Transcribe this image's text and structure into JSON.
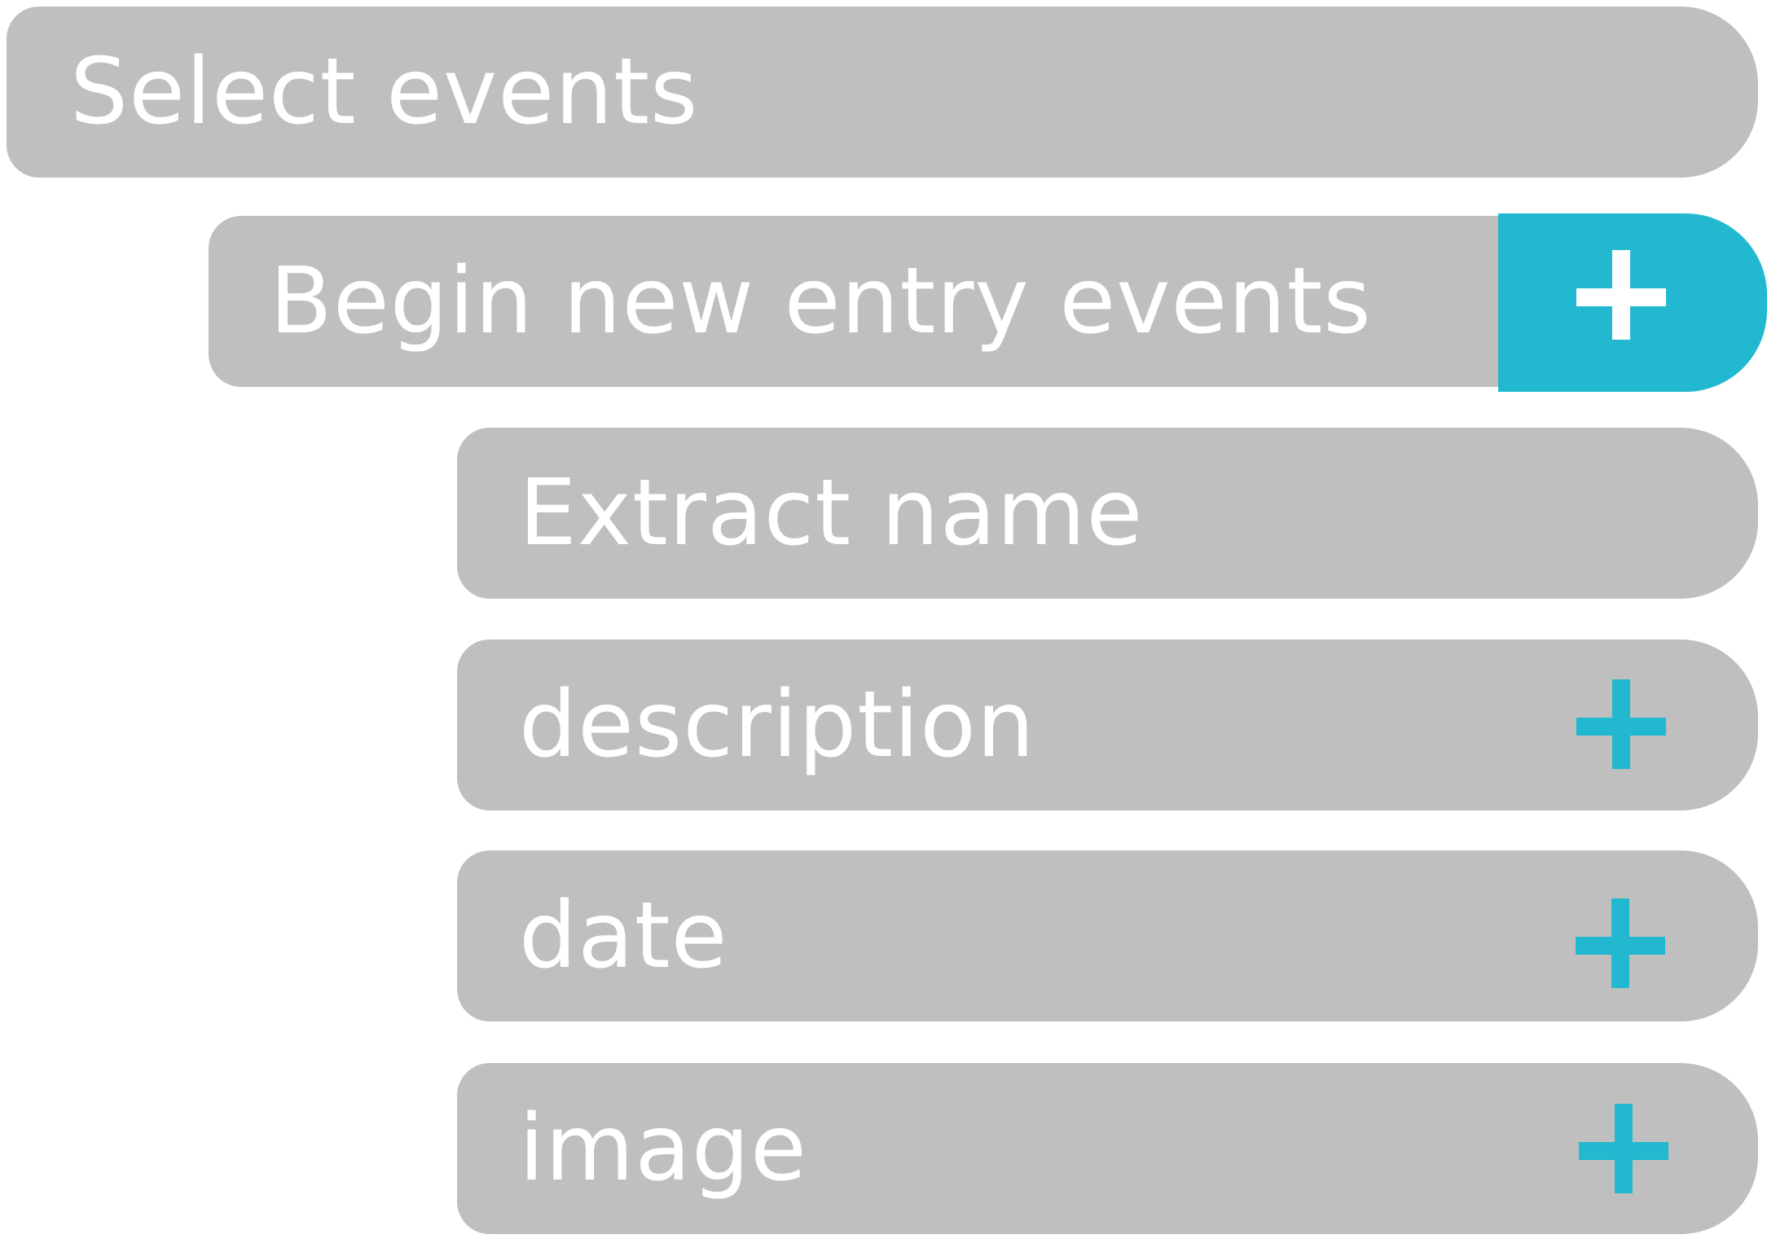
{
  "rows": {
    "select_events": "Select events",
    "begin_new_entry_events": "Begin new entry events",
    "extract_name": "Extract name",
    "description": "description",
    "date": "date",
    "image": "image"
  },
  "icons": {
    "add": "plus-icon"
  },
  "colors": {
    "row_bg": "#bfbfbf",
    "accent": "#22b9d0",
    "text": "#ffffff"
  }
}
